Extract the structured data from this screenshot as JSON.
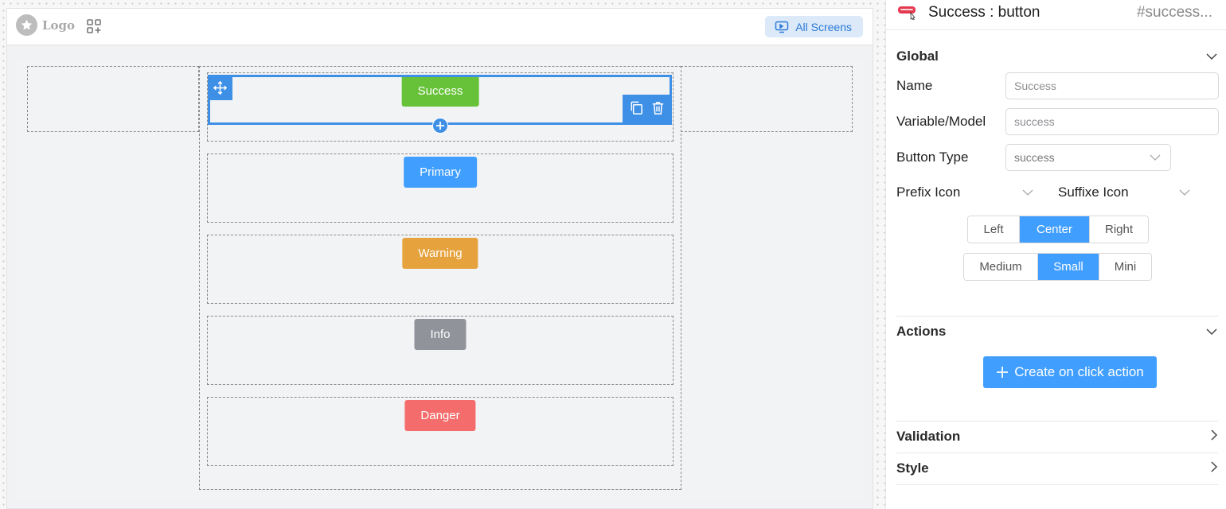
{
  "header": {
    "logo_text": "Logo",
    "all_screens_label": "All Screens"
  },
  "canvas": {
    "buttons": [
      {
        "label": "Success",
        "color": "#67c23a"
      },
      {
        "label": "Primary",
        "color": "#409eff"
      },
      {
        "label": "Warning",
        "color": "#e6a23c"
      },
      {
        "label": "Info",
        "color": "#909399"
      },
      {
        "label": "Danger",
        "color": "#f56c6c"
      }
    ],
    "selected_index": 0
  },
  "panel": {
    "title": "Success : button",
    "component_id": "#success...",
    "global": {
      "heading": "Global",
      "name_label": "Name",
      "name_value": "Success",
      "variable_label": "Variable/Model",
      "variable_value": "success",
      "type_label": "Button Type",
      "type_value": "success",
      "prefix_label": "Prefix Icon",
      "suffix_label": "Suffixe Icon",
      "alignment": {
        "options": [
          "Left",
          "Center",
          "Right"
        ],
        "selected": "Center"
      },
      "size": {
        "options": [
          "Medium",
          "Small",
          "Mini"
        ],
        "selected": "Small"
      }
    },
    "actions": {
      "heading": "Actions",
      "create_label": "Create on click action"
    },
    "validation_heading": "Validation",
    "style_heading": "Style"
  },
  "colors": {
    "accent": "#409eff",
    "selection": "#3e8fe6"
  }
}
